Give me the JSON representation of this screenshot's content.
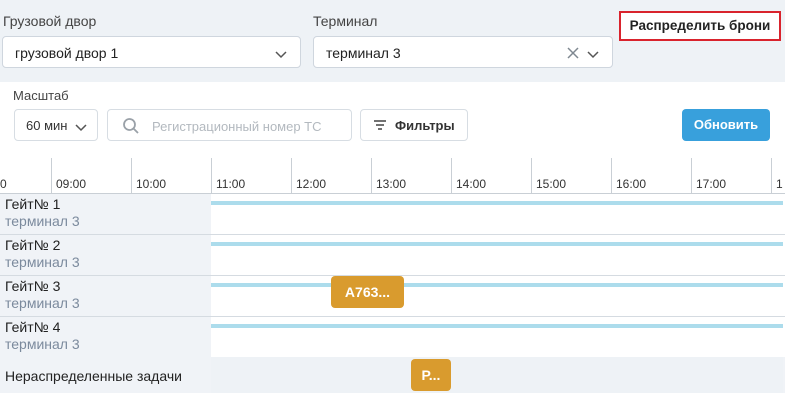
{
  "filters": {
    "yard_label": "Грузовой двор",
    "yard_value": "грузовой двор 1",
    "terminal_label": "Терминал",
    "terminal_value": "терминал 3",
    "distribute_button": "Распределить брони"
  },
  "toolbar": {
    "scale_label": "Масштаб",
    "scale_value": "60 мин",
    "search_placeholder": "Регистрационный номер ТС",
    "filters_button": "Фильтры",
    "refresh_button": "Обновить"
  },
  "timeline": {
    "ticks": [
      "0",
      "09:00",
      "10:00",
      "11:00",
      "12:00",
      "13:00",
      "14:00",
      "15:00",
      "16:00",
      "17:00",
      "1"
    ]
  },
  "gates": [
    {
      "name": "Гейт№ 1",
      "terminal": "терминал 3"
    },
    {
      "name": "Гейт№ 2",
      "terminal": "терминал 3"
    },
    {
      "name": "Гейт№ 3",
      "terminal": "терминал 3",
      "task": "А763..."
    },
    {
      "name": "Гейт№ 4",
      "terminal": "терминал 3"
    }
  ],
  "unassigned": {
    "label": "Нераспределенные задачи",
    "task": "Р..."
  },
  "colors": {
    "accent": "#38a0dc",
    "task": "#d99b2e",
    "highlight_border": "#d9232d",
    "availability_line": "#acdcec"
  }
}
